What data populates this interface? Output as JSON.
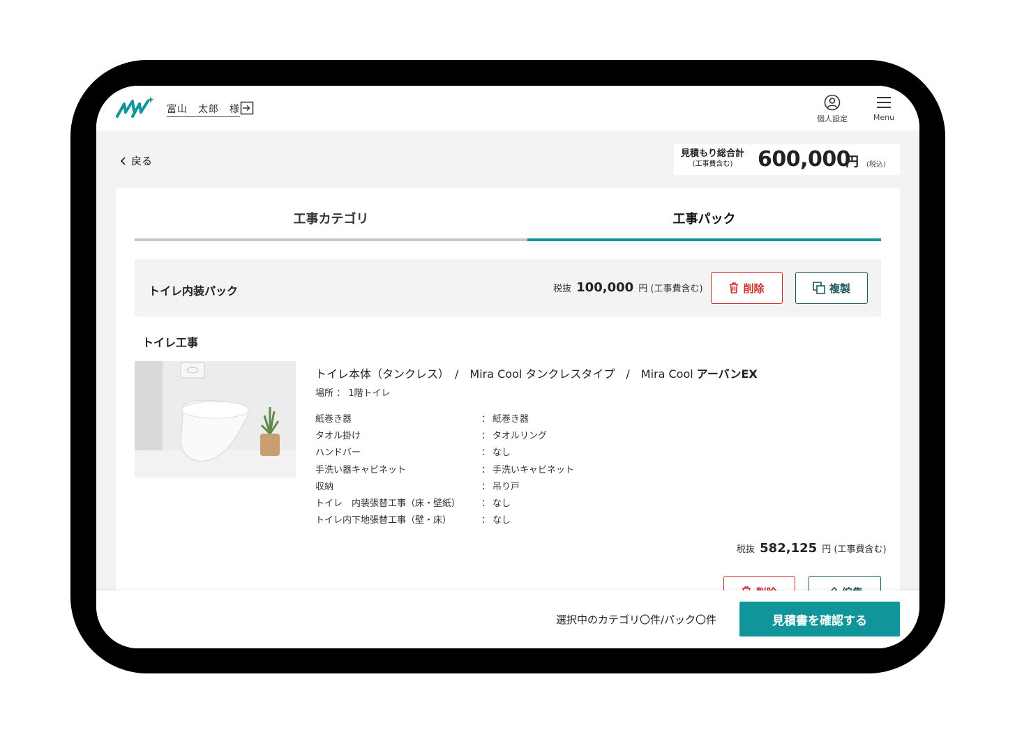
{
  "header": {
    "user_name": "富山　太郎　様",
    "personal_settings_label": "個人設定",
    "menu_label": "Menu"
  },
  "topbar": {
    "back_label": "戻る",
    "total_label": "見積もり総合計",
    "total_sublabel": "(工事費含む)",
    "total_amount": "600,000",
    "total_currency": "円",
    "total_tax_note": "(税込)"
  },
  "tabs": [
    {
      "label": "工事カテゴリ",
      "active": false
    },
    {
      "label": "工事パック",
      "active": true
    }
  ],
  "pack": {
    "title": "トイレ内装パック",
    "price_prefix": "税抜",
    "price": "100,000",
    "price_suffix": "円 (工事費含む)",
    "delete_label": "削除",
    "copy_label": "複製"
  },
  "section": {
    "title": "トイレ工事",
    "product_name_main": "トイレ本体（タンクレス）　/　Mira Cool タンクレスタイプ　/　Mira Cool ",
    "product_name_bold": "アーバンEX",
    "place": "場所 ： 1階トイレ",
    "specs": [
      {
        "key": "紙巻き器",
        "sep": "：",
        "value": "紙巻き器"
      },
      {
        "key": "タオル掛け",
        "sep": "：",
        "value": "タオルリング"
      },
      {
        "key": "ハンドバー",
        "sep": "：",
        "value": "なし"
      },
      {
        "key": "手洗い器キャビネット",
        "sep": "：",
        "value": "手洗いキャビネット"
      },
      {
        "key": "収納",
        "sep": "：",
        "value": "吊り戸"
      },
      {
        "key": "トイレ　内装張替工事（床・壁紙）",
        "sep": "：",
        "value": "なし"
      },
      {
        "key": "トイレ内下地張替工事（壁・床）",
        "sep": "：",
        "value": "なし"
      }
    ],
    "price_prefix": "税抜",
    "price": "582,125",
    "price_suffix": "円 (工事費含む)",
    "delete_label": "削除",
    "edit_label": "編集"
  },
  "footer": {
    "status": "選択中のカテゴリ〇件/パック〇件",
    "confirm_label": "見積書を確認する"
  },
  "colors": {
    "accent": "#10959a",
    "danger": "#d12b2b",
    "secondary": "#1f5a5c"
  }
}
